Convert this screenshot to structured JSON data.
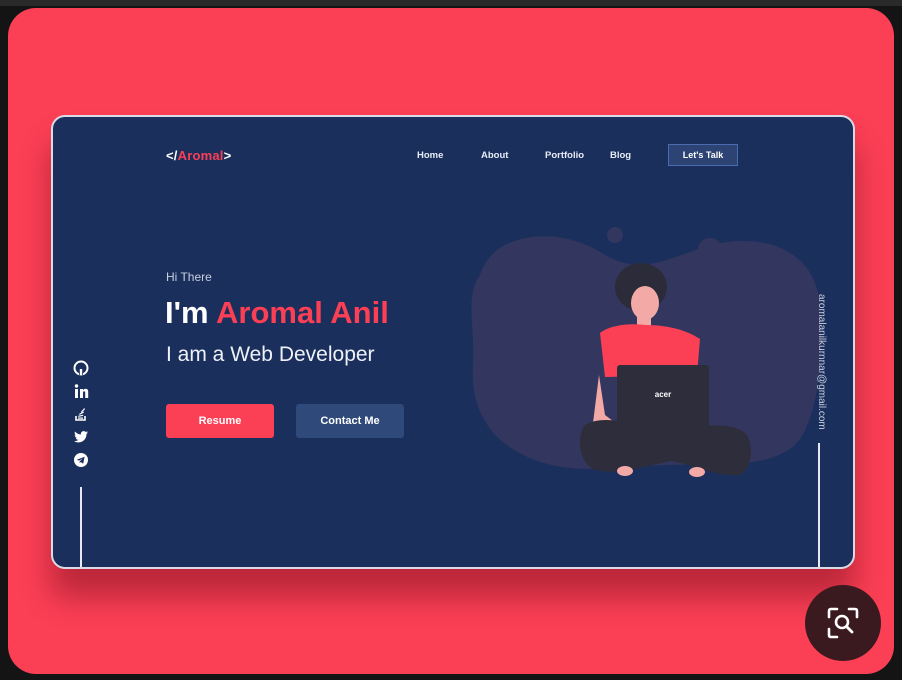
{
  "logo": {
    "prefix": "</",
    "name": "Aromal",
    "suffix": ">"
  },
  "nav": {
    "items": [
      {
        "label": "Home"
      },
      {
        "label": "About"
      },
      {
        "label": "Portfolio"
      },
      {
        "label": "Blog"
      }
    ],
    "cta_label": "Let's Talk"
  },
  "hero": {
    "greeting": "Hi There",
    "headline_prefix": "I'm",
    "headline_name": "Aromal Anil",
    "subtitle": "I am a Web Developer",
    "primary_button": "Resume",
    "secondary_button": "Contact Me"
  },
  "illustration": {
    "laptop_brand": "acer"
  },
  "side": {
    "email": "aromalanilkurnnar@gmail.com"
  },
  "social_icons": [
    "github-icon",
    "linkedin-icon",
    "stackoverflow-icon",
    "twitter-icon",
    "telegram-icon"
  ],
  "colors": {
    "page_background": "#fb3f55",
    "card_background": "#1b2f5c",
    "accent": "#fb3f55",
    "button_secondary": "#2f4a7a",
    "blob": "#33375f"
  },
  "overlay": {
    "icon": "visual-search-icon"
  }
}
